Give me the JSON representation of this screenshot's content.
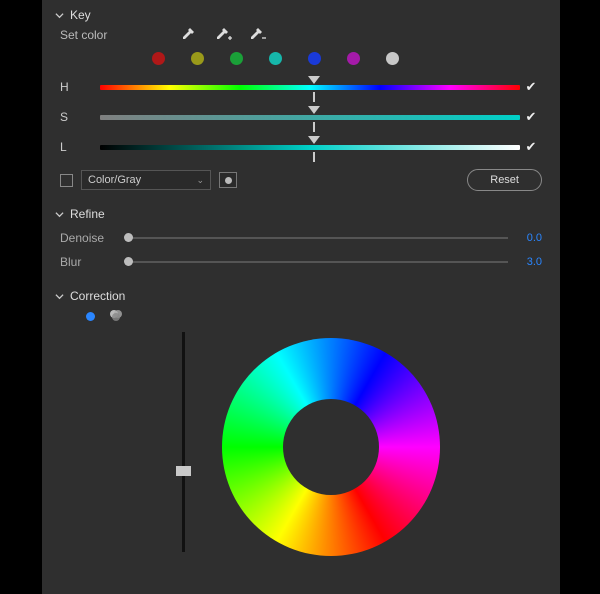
{
  "key": {
    "title": "Key",
    "set_color_label": "Set color",
    "swatches": [
      "#b01818",
      "#9a9a1a",
      "#1aa038",
      "#16b7ab",
      "#1a3ad8",
      "#a41aa8",
      "#c8c8c8"
    ],
    "sliders": {
      "h": {
        "label": "H",
        "pos": 0.51,
        "checked": true
      },
      "s": {
        "label": "S",
        "pos": 0.51,
        "checked": true
      },
      "l": {
        "label": "L",
        "pos": 0.51,
        "checked": true
      }
    },
    "color_gray": {
      "checkbox": false,
      "label": "Color/Gray"
    },
    "reset_label": "Reset"
  },
  "refine": {
    "title": "Refine",
    "denoise": {
      "label": "Denoise",
      "value": "0.0",
      "pos": 0.0
    },
    "blur": {
      "label": "Blur",
      "value": "3.0",
      "pos": 0.0
    }
  },
  "correction": {
    "title": "Correction",
    "active_dot": "#2a86ff",
    "vslider_pos": 0.64
  }
}
